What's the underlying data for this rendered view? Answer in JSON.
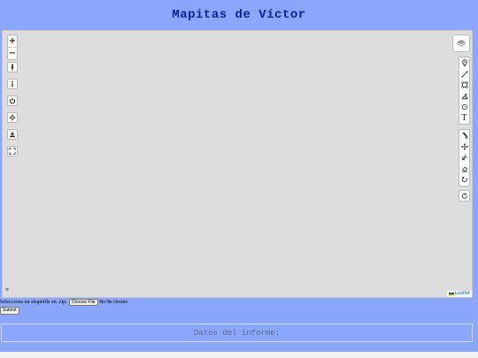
{
  "header": {
    "title": "Mapitas de Víctor"
  },
  "map": {
    "zoom_in_label": "+",
    "zoom_out_label": "−",
    "left_controls": [
      "person-icon",
      "info-icon",
      "power-icon",
      "crosshair-icon",
      "download-icon",
      "fullscreen-icon"
    ],
    "layers_control": "layers-icon",
    "draw_tools": [
      "marker-icon",
      "polyline-icon",
      "rectangle-icon",
      "polygon-icon",
      "circle-icon",
      "text-icon"
    ],
    "text_tool_label": "T",
    "edit_tools": [
      "cut-icon",
      "move-icon",
      "scissors-icon",
      "eraser-icon",
      "rotate-icon"
    ],
    "extra_tool": "circle-arrow-icon",
    "scale_mark": "≡",
    "attribution": "Leaflet"
  },
  "upload": {
    "label": "Selecciona un shapefile en .zip:",
    "file_button": "Choose File",
    "file_status": "No file chosen",
    "submit_label": "Submit"
  },
  "report": {
    "title": "Datos del informe:"
  }
}
